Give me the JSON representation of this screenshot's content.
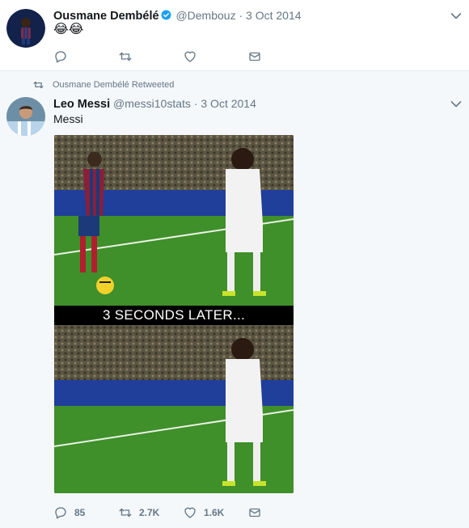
{
  "tweet1": {
    "name": "Ousmane Dembélé",
    "handle": "@Dembouz",
    "separator": "·",
    "date": "3 Oct 2014",
    "text": "😂😂",
    "actions": {
      "reply_count": "",
      "retweet_count": "",
      "like_count": ""
    }
  },
  "tweet2": {
    "retweet_context": "Ousmane Dembélé Retweeted",
    "name": "Leo Messi",
    "handle": "@messi10stats",
    "separator": "·",
    "date": "3 Oct 2014",
    "text": "Messi",
    "media_caption": "3 SECONDS LATER...",
    "actions": {
      "reply_count": "85",
      "retweet_count": "2.7K",
      "like_count": "1.6K"
    }
  },
  "colors": {
    "secondary_text": "#657786",
    "verified_blue": "#1da1f2",
    "divider": "#e6ecf0",
    "retweet_bg": "#f5f8fa"
  },
  "icons": [
    "reply-icon",
    "retweet-icon",
    "like-icon",
    "dm-icon",
    "chevron-down-icon",
    "verified-icon"
  ]
}
